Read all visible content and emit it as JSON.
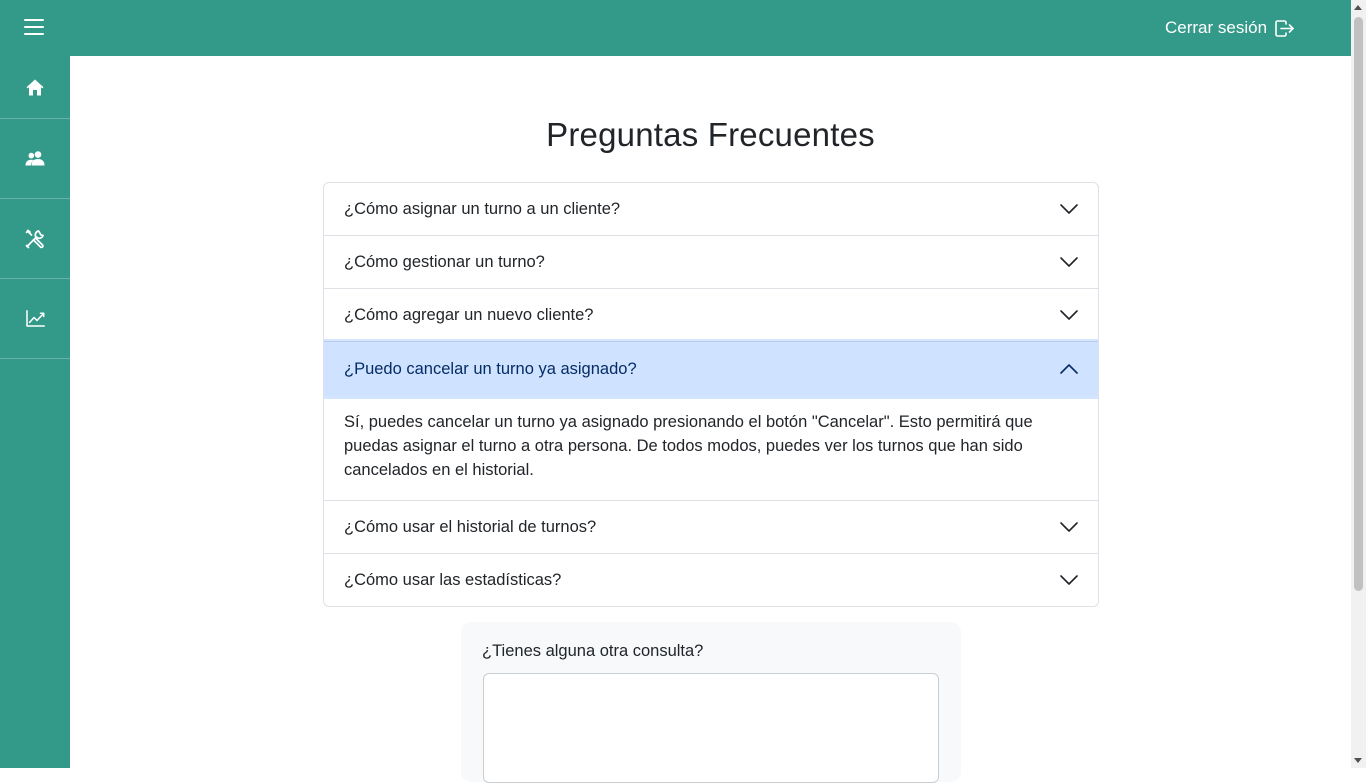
{
  "header": {
    "menu_icon": "hamburger-menu-icon",
    "logout_label": "Cerrar sesión",
    "logout_icon": "box-arrow-right-icon",
    "bg_color": "#339a89"
  },
  "sidebar": {
    "items": [
      {
        "icon": "house-icon"
      },
      {
        "icon": "people-icon"
      },
      {
        "icon": "tools-icon"
      },
      {
        "icon": "graph-up-icon"
      }
    ]
  },
  "main": {
    "title": "Preguntas Frecuentes",
    "faqs": [
      {
        "question": "¿Cómo asignar un turno a un cliente?",
        "expanded": false
      },
      {
        "question": "¿Cómo gestionar un turno?",
        "expanded": false
      },
      {
        "question": "¿Cómo agregar un nuevo cliente?",
        "expanded": false
      },
      {
        "question": "¿Puedo cancelar un turno ya asignado?",
        "expanded": true,
        "answer": "Sí, puedes cancelar un turno ya asignado presionando el botón \"Cancelar\". Esto permitirá que puedas asignar el turno a otra persona. De todos modos, puedes ver los turnos que han sido cancelados en el historial."
      },
      {
        "question": "¿Cómo usar el historial de turnos?",
        "expanded": false
      },
      {
        "question": "¿Cómo usar las estadísticas?",
        "expanded": false
      }
    ],
    "contact": {
      "label": "¿Tienes alguna otra consulta?",
      "value": ""
    }
  },
  "colors": {
    "accent": "#339a89",
    "expanded_header": "#cfe2ff",
    "expanded_text": "#052c65"
  }
}
